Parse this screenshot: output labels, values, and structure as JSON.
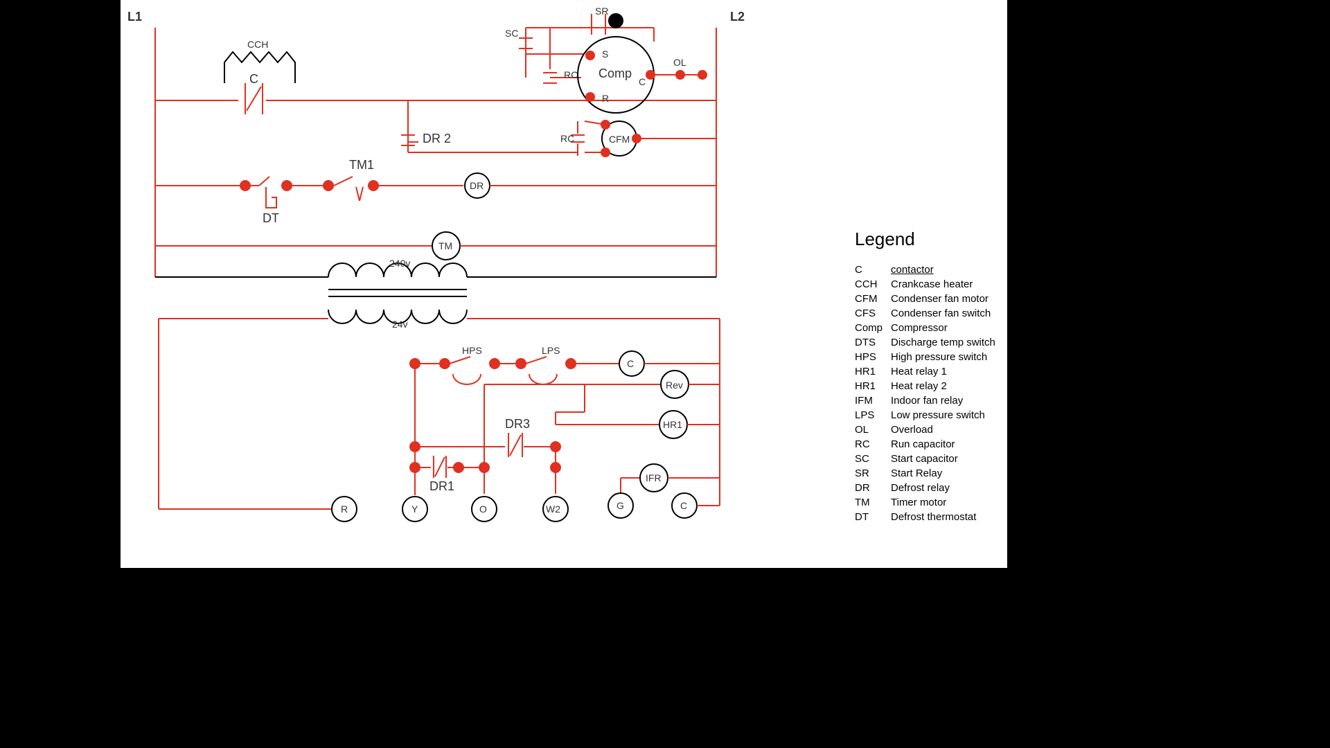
{
  "rails": {
    "left": "L1",
    "right": "L2"
  },
  "transformer": {
    "primary": "240v",
    "secondary": "24v"
  },
  "symbols": {
    "CCH": "CCH",
    "C": "C",
    "SC": "SC",
    "SR": "SR",
    "RC": "RC",
    "OL": "OL",
    "Comp": "Comp",
    "S": "S",
    "Rlet": "R",
    "Clet": "C",
    "DR2": "DR 2",
    "CFM": "CFM",
    "RC2": "RC",
    "TM1": "TM1",
    "DT": "DT",
    "DR": "DR",
    "TM": "TM",
    "HPS": "HPS",
    "LPS": "LPS",
    "Ccoil": "C",
    "Rev": "Rev",
    "HR1": "HR1",
    "DR3": "DR3",
    "DR1": "DR1",
    "IFR": "IFR",
    "termR": "R",
    "termY": "Y",
    "termO": "O",
    "termW2": "W2",
    "termG": "G",
    "termC": "C"
  },
  "legend": {
    "title": "Legend",
    "items": [
      {
        "k": "C",
        "v": "contactor",
        "u": true
      },
      {
        "k": "CCH",
        "v": "Crankcase heater"
      },
      {
        "k": "CFM",
        "v": "Condenser fan motor"
      },
      {
        "k": "CFS",
        "v": "Condenser fan switch"
      },
      {
        "k": "Comp",
        "v": "Compressor"
      },
      {
        "k": "DTS",
        "v": "Discharge temp switch"
      },
      {
        "k": "HPS",
        "v": "High pressure switch"
      },
      {
        "k": "HR1",
        "v": "Heat relay 1"
      },
      {
        "k": "HR1",
        "v": "Heat relay 2"
      },
      {
        "k": "IFM",
        "v": "Indoor fan relay"
      },
      {
        "k": "LPS",
        "v": "Low pressure switch"
      },
      {
        "k": "OL",
        "v": "Overload"
      },
      {
        "k": "RC",
        "v": "Run capacitor"
      },
      {
        "k": "SC",
        "v": "Start capacitor"
      },
      {
        "k": "SR",
        "v": "Start Relay"
      },
      {
        "k": "DR",
        "v": "Defrost relay"
      },
      {
        "k": "TM",
        "v": "Timer motor"
      },
      {
        "k": "DT",
        "v": "Defrost thermostat"
      }
    ]
  }
}
